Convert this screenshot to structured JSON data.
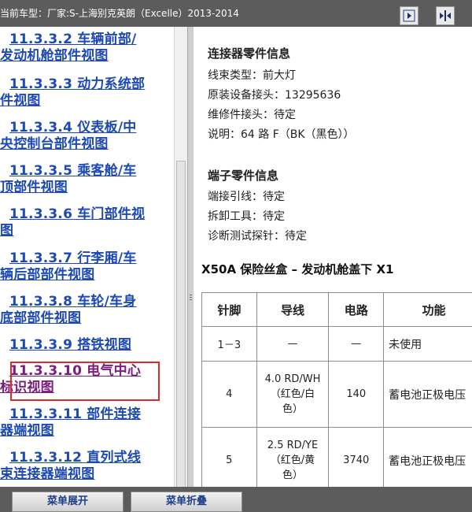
{
  "topbar": {
    "title": "当前车型：厂家:S-上海别克英朗（Excelle）2013-2014",
    "buttons": [
      {
        "name": "expand-right-button",
        "icon": "arrow-right-icon"
      },
      {
        "name": "collapse-split-button",
        "icon": "arrows-inward-icon"
      }
    ]
  },
  "nav": {
    "items": [
      {
        "lines": [
          "11.3.3.2 车辆前部/",
          "发动机舱部件视图"
        ],
        "visited": false
      },
      {
        "lines": [
          "11.3.3.3 动力系统部",
          "件视图"
        ],
        "visited": false
      },
      {
        "lines": [
          "11.3.3.4 仪表板/中",
          "央控制台部件视图"
        ],
        "visited": false
      },
      {
        "lines": [
          "11.3.3.5 乘客舱/车",
          "顶部件视图"
        ],
        "visited": false
      },
      {
        "lines": [
          "11.3.3.6 车门部件视",
          "图"
        ],
        "visited": false
      },
      {
        "lines": [
          "11.3.3.7 行李厢/车",
          "辆后部部件视图"
        ],
        "visited": false
      },
      {
        "lines": [
          "11.3.3.8 车轮/车身",
          "底部部件视图"
        ],
        "visited": false
      },
      {
        "lines": [
          "11.3.3.9 搭铁视图"
        ],
        "visited": false
      },
      {
        "lines": [
          "11.3.3.10 电气中心",
          "标识视图"
        ],
        "visited": true
      },
      {
        "lines": [
          "11.3.3.11 部件连接",
          "器端视图"
        ],
        "visited": false
      },
      {
        "lines": [
          "11.3.3.12 直列式线",
          "束连接器端视图"
        ],
        "visited": false
      }
    ]
  },
  "content": {
    "connector": {
      "title": "连接器零件信息",
      "lines": [
        "线束类型：前大灯",
        "原装设备接头：13295636",
        "维修件接头：待定",
        "说明：64 路 F（BK（黑色））"
      ]
    },
    "terminal": {
      "title": "端子零件信息",
      "lines": [
        "端接引线：待定",
        "拆卸工具：待定",
        "诊断测试探针：待定"
      ]
    },
    "fuse_title": "X50A 保险丝盒 – 发动机舱盖下 X1",
    "table": {
      "headers": [
        "针脚",
        "导线",
        "电路",
        "功能"
      ],
      "rows": [
        {
          "pin": "1－3",
          "wire": [
            "—"
          ],
          "circuit": "—",
          "func": "未使用"
        },
        {
          "pin": "4",
          "wire": [
            "4.0 RD/WH",
            "（红色/白",
            "色）"
          ],
          "circuit": "140",
          "func": "蓄电池正极电压"
        },
        {
          "pin": "5",
          "wire": [
            "2.5 RD/YE",
            "（红色/黄",
            "色）"
          ],
          "circuit": "3740",
          "func": "蓄电池正极电压"
        }
      ]
    }
  },
  "bottombar": {
    "expand_label": "菜单展开",
    "collapse_label": "菜单折叠"
  }
}
